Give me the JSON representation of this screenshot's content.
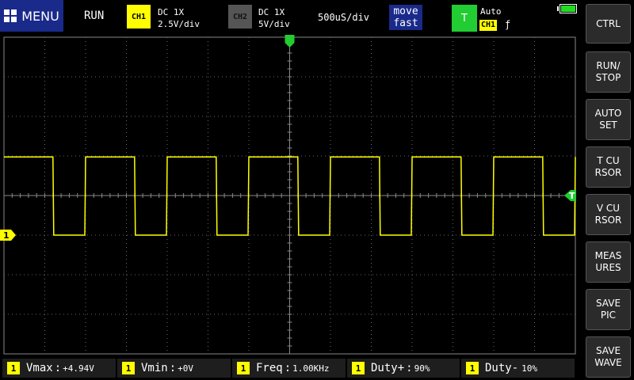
{
  "menu": {
    "label": "MENU"
  },
  "status": {
    "run_state": "RUN"
  },
  "ch1": {
    "badge": "CH1",
    "coupling": "DC  1X",
    "scale": "2.5V/div",
    "color": "#ffff00"
  },
  "ch2": {
    "badge": "CH2",
    "coupling": "DC  1X",
    "scale": "5V/div",
    "color": "#555555"
  },
  "timebase": "500uS/div",
  "move": {
    "line1": "move",
    "line2": "fast"
  },
  "trigger": {
    "badge": "T",
    "mode": "Auto",
    "source": "CH1",
    "edge": "ƒ",
    "color": "#22cc33"
  },
  "battery_icon": "battery-full-icon",
  "side_buttons": [
    {
      "label": "CTRL"
    },
    {
      "label": "RUN/\nSTOP"
    },
    {
      "label": "AUTO\nSET"
    },
    {
      "label": "T CU\nRSOR"
    },
    {
      "label": "V CU\nRSOR"
    },
    {
      "label": "MEAS\nURES"
    },
    {
      "label": "SAVE\nPIC"
    },
    {
      "label": "SAVE\nWAVE"
    }
  ],
  "measurements": [
    {
      "ch": "1",
      "label": "Vmax",
      "value": "+4.94V"
    },
    {
      "ch": "1",
      "label": "Vmin",
      "value": "+0V"
    },
    {
      "ch": "1",
      "label": "Freq",
      "value": "1.00KHz"
    },
    {
      "ch": "1",
      "label": "Duty+",
      "value": "90%"
    },
    {
      "ch": "1",
      "label": "Duty-",
      "value": "10%"
    }
  ],
  "markers": {
    "ch1": "1",
    "trigger": "T"
  },
  "chart_data": {
    "type": "line",
    "title": "",
    "xlabel": "",
    "ylabel": "",
    "series": [
      {
        "x_ms": [
          0,
          0.6,
          0.61,
          0.99,
          1.0,
          1.6,
          1.61,
          1.99,
          2.0,
          2.6,
          2.61,
          2.99,
          3.0,
          3.6,
          3.61,
          3.99,
          4.0,
          4.6,
          4.61,
          4.99,
          5.0,
          5.6,
          5.61,
          5.99,
          6.0,
          6.6,
          6.61,
          6.99,
          7.0
        ],
        "y_v": [
          4.94,
          4.94,
          0,
          0,
          4.94,
          4.94,
          0,
          0,
          4.94,
          4.94,
          0,
          0,
          4.94,
          4.94,
          0,
          0,
          4.94,
          4.94,
          0,
          0,
          4.94,
          4.94,
          0,
          0,
          4.94,
          4.94,
          0,
          0,
          4.94
        ]
      }
    ],
    "time_per_div_ms": 0.5,
    "volts_per_div": 2.5,
    "divisions_x": 14,
    "divisions_y": 8,
    "ch1_zero_div_from_top": 5,
    "trigger_div_from_top": 4,
    "grid": true,
    "trace_color": "#ffff00"
  }
}
